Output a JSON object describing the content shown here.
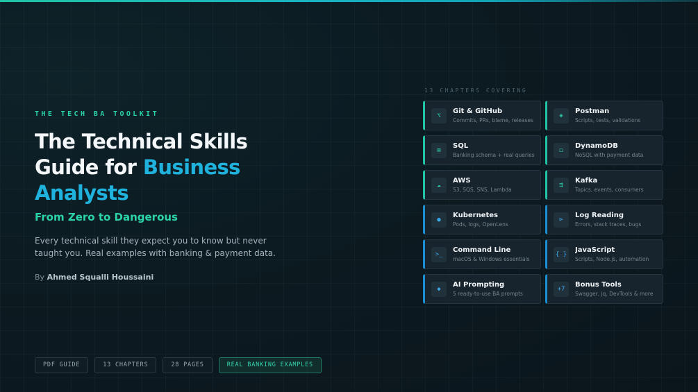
{
  "eyebrow": "THE TECH BA TOOLKIT",
  "title": {
    "line1": "The Technical Skills",
    "line2_pre": "Guide for ",
    "line2_accent": "Business",
    "line3_accent": "Analysts"
  },
  "subtitle": "From Zero to Dangerous",
  "description": "Every technical skill they expect you to know but never taught you. Real examples with banking & payment data.",
  "byline": {
    "prefix": "By ",
    "author": "Ahmed Squalli Houssaini"
  },
  "tags": [
    "PDF GUIDE",
    "13 CHAPTERS",
    "28 PAGES",
    "REAL BANKING EXAMPLES"
  ],
  "chapters_label": "13 CHAPTERS COVERING",
  "chapters": [
    {
      "title": "Git & GitHub",
      "sub": "Commits, PRs, blame, releases",
      "icon": "⌥",
      "icon_name": "git-icon"
    },
    {
      "title": "Postman",
      "sub": "Scripts, tests, validations",
      "icon": "◈",
      "icon_name": "postman-icon"
    },
    {
      "title": "SQL",
      "sub": "Banking schema + real queries",
      "icon": "⊞",
      "icon_name": "table-icon"
    },
    {
      "title": "DynamoDB",
      "sub": "NoSQL with payment data",
      "icon": "◻",
      "icon_name": "database-icon"
    },
    {
      "title": "AWS",
      "sub": "S3, SQS, SNS, Lambda",
      "icon": "☁",
      "icon_name": "cloud-icon"
    },
    {
      "title": "Kafka",
      "sub": "Topics, events, consumers",
      "icon": "⇶",
      "icon_name": "stream-icon"
    },
    {
      "title": "Kubernetes",
      "sub": "Pods, logs, OpenLens",
      "icon": "●",
      "icon_name": "kubernetes-icon"
    },
    {
      "title": "Log Reading",
      "sub": "Errors, stack traces, bugs",
      "icon": "⊳",
      "icon_name": "log-icon"
    },
    {
      "title": "Command Line",
      "sub": "macOS & Windows essentials",
      "icon": ">_",
      "icon_name": "terminal-icon"
    },
    {
      "title": "JavaScript",
      "sub": "Scripts, Node.js, automation",
      "icon": "{ }",
      "icon_name": "code-braces-icon"
    },
    {
      "title": "AI Prompting",
      "sub": "5 ready-to-use BA prompts",
      "icon": "◆",
      "icon_name": "sparkle-icon"
    },
    {
      "title": "Bonus Tools",
      "sub": "Swagger, jq, DevTools & more",
      "icon": "+7",
      "icon_name": "plus-seven-icon"
    }
  ],
  "colors": {
    "accent_teal": "#22c4a6",
    "accent_blue": "#1fb2dd",
    "background": "#0c1a21",
    "card": "#17232d"
  }
}
